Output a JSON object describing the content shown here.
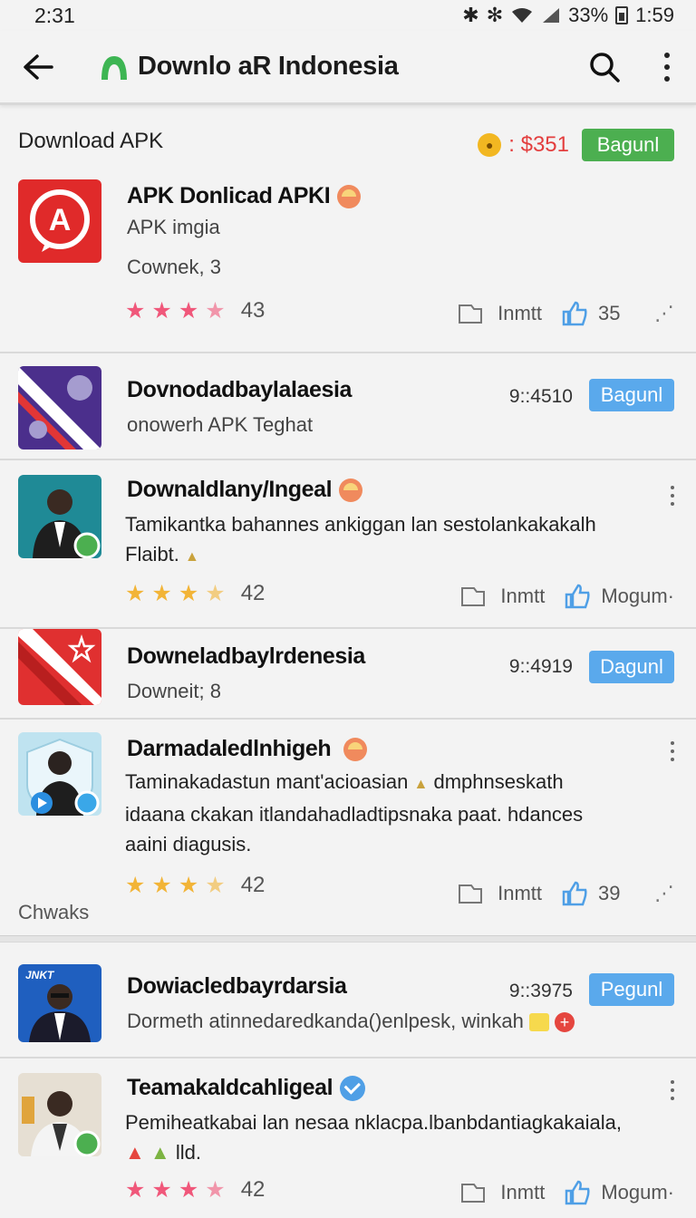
{
  "status": {
    "time": "2:31",
    "battery": "33%",
    "clock": "1:59"
  },
  "appbar": {
    "title": "Downlo aR Indonesia",
    "brand_color": "#3db553"
  },
  "section": {
    "label": "Download APK",
    "price": ": $351",
    "button": "Bagunl"
  },
  "cards": [
    {
      "title": "APK Donlicad APKI",
      "sub1": "APK imgia",
      "sub2": "Cownek, 3",
      "rating": "43",
      "action1": "Inmtt",
      "action2": "35",
      "star_color": "#f0577a"
    },
    {
      "title": "Dovnodadbaylalaesia",
      "sub1": "onowerh APK Teghat",
      "time": "9::4510",
      "button": "Bagunl"
    },
    {
      "title": "Downaldlany/Ingeal",
      "desc1": "Tamikantka bahannes ankiggan lan sestolankakakalh",
      "desc2": "Flaibt.",
      "rating": "42",
      "action1": "Inmtt",
      "action2": "Mogum·",
      "star_color": "#f2b437"
    },
    {
      "title": "Downeladbaylrdenesia",
      "sub1": "Downeit; 8",
      "time": "9::4919",
      "button": "Dagunl"
    },
    {
      "title": "Darmadaledlnhigeh",
      "desc1": "Taminakadastun mant'acioasian",
      "desc1b": "dmphnseskath",
      "desc2": "idaana ckakan itlandahadladtipsnaka paat. hdances",
      "desc3": "aaini diagusis.",
      "rating": "42",
      "action1": "Inmtt",
      "action2": "39",
      "footer": "Chwaks",
      "star_color": "#f2b437"
    },
    {
      "title": "Dowiacledbayrdarsia",
      "sub1": "Dormeth atinnedaredkanda()enlpesk, winkah",
      "time": "9::3975",
      "button": "Pegunl",
      "thumb_label": "JNKT"
    },
    {
      "title": "Teamakaldcahligeal",
      "desc1": "Pemiheatkabai lan nesaa nklacpa.lbanbdantiagkakaiala,",
      "desc2": "lld.",
      "rating": "42",
      "action1": "Inmtt",
      "action2": "Mogum·",
      "star_color": "#f0577a"
    }
  ]
}
